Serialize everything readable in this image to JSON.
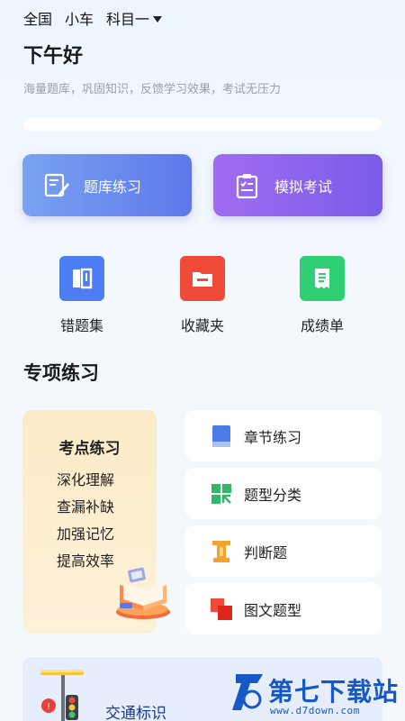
{
  "topbar": {
    "region": "全国",
    "vehicle": "小车",
    "subject": "科目一"
  },
  "greeting": "下午好",
  "slogan": "海量题库，巩固知识，反馈学习效果，考试无压力",
  "main_buttons": {
    "bank": "题库练习",
    "exam": "模拟考试"
  },
  "quick_links": [
    {
      "label": "错题集",
      "icon": "book-icon"
    },
    {
      "label": "收藏夹",
      "icon": "folder-icon"
    },
    {
      "label": "成绩单",
      "icon": "receipt-icon"
    }
  ],
  "section_title": "专项练习",
  "point_card": {
    "title": "考点练习",
    "lines": [
      "深化理解",
      "查漏补缺",
      "加强记忆",
      "提高效率"
    ]
  },
  "categories": [
    {
      "label": "章节练习",
      "icon": "book-blue-icon"
    },
    {
      "label": "题型分类",
      "icon": "grid-green-icon"
    },
    {
      "label": "判断题",
      "icon": "pillar-orange-icon"
    },
    {
      "label": "图文题型",
      "icon": "squares-red-icon"
    }
  ],
  "traffic_card": {
    "label": "交通标识"
  },
  "watermark": {
    "brand": "第七下载站",
    "url": "www.d7down.com"
  },
  "colors": {
    "bank": "#5d78ea",
    "exam": "#7a5ce8",
    "red": "#f04b39",
    "green": "#2fcf74",
    "brand": "#1558c6"
  }
}
